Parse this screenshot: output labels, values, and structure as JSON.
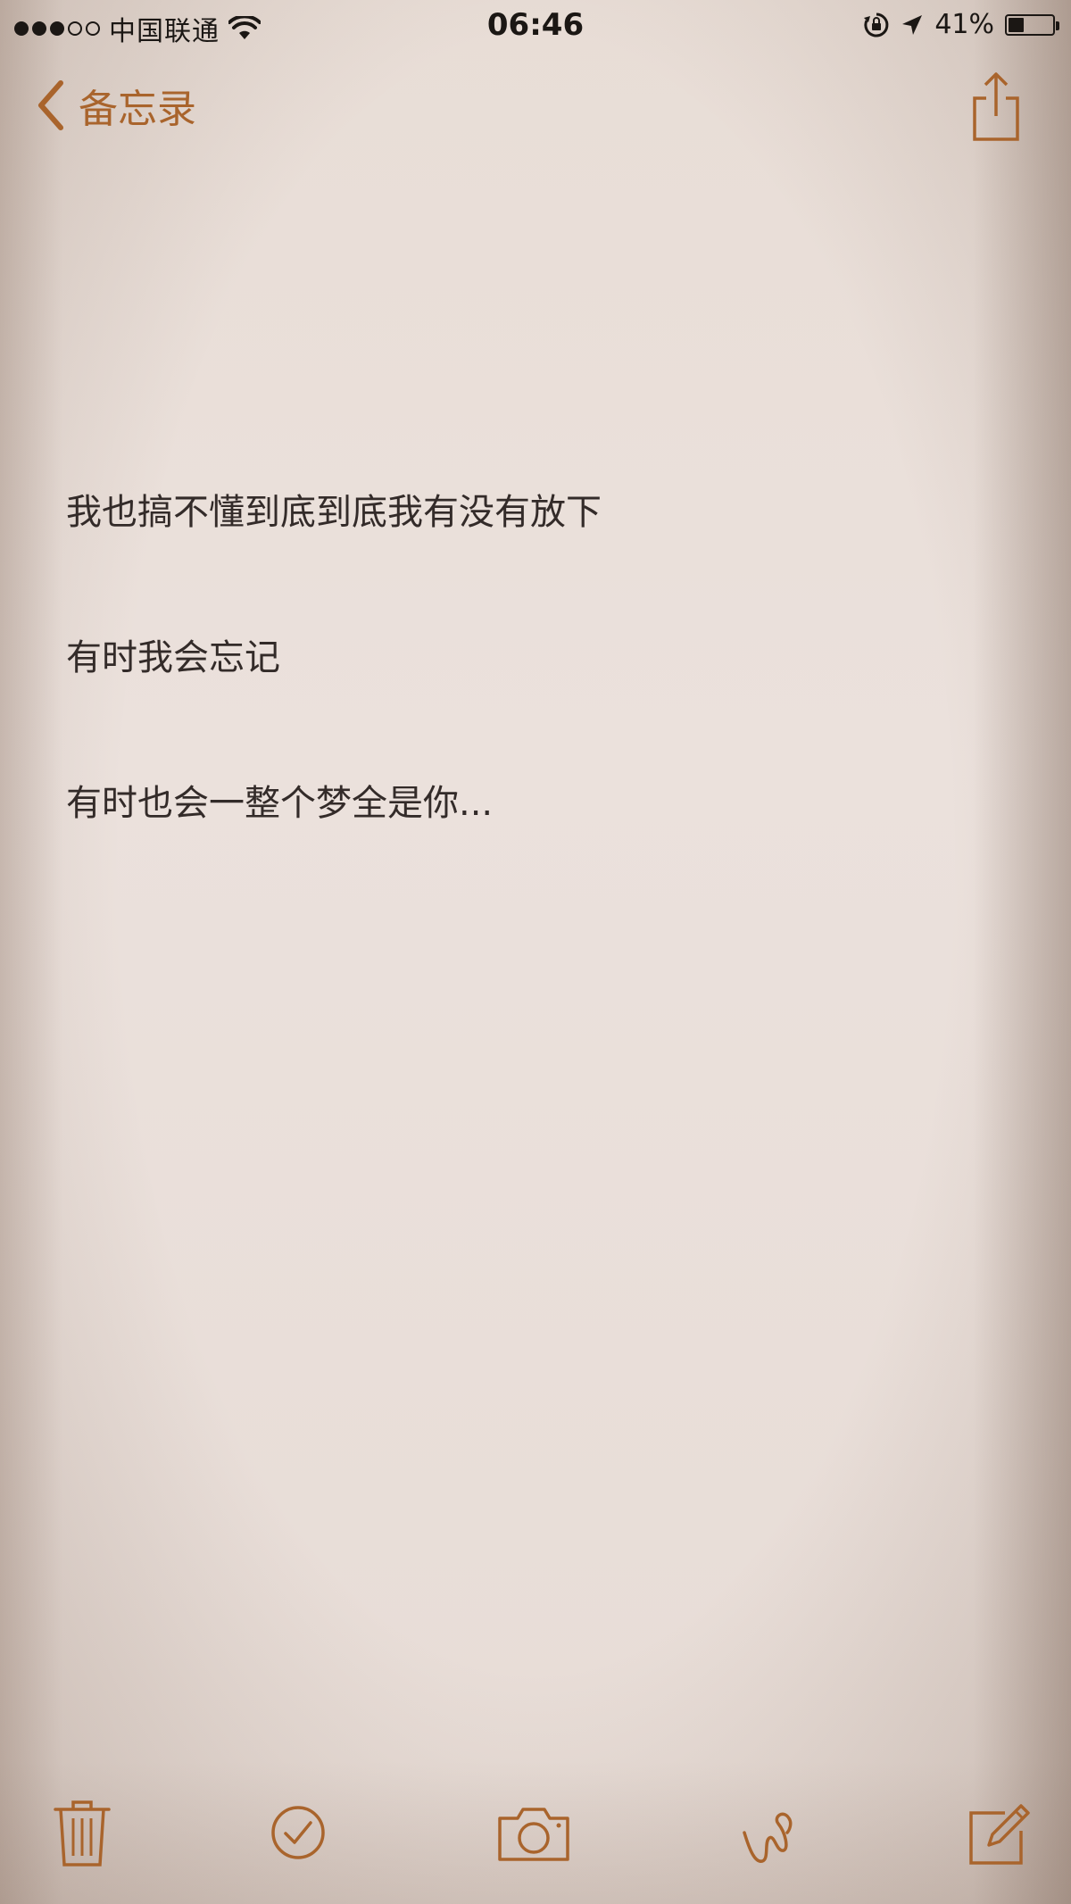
{
  "status_bar": {
    "carrier": "中国联通",
    "time": "06:46",
    "battery_percent_text": "41%",
    "battery_level": 0.41
  },
  "nav": {
    "back_label": "备忘录"
  },
  "note": {
    "lines": [
      "我也搞不懂到底到底我有没有放下",
      "有时我会忘记",
      "有时也会一整个梦全是你..."
    ]
  },
  "toolbar": {
    "icons": [
      "trash-icon",
      "checklist-icon",
      "camera-icon",
      "sketch-icon",
      "compose-icon"
    ]
  },
  "colors": {
    "accent": "#a9642c",
    "text": "#332b29",
    "paper": "#e9ded8"
  }
}
